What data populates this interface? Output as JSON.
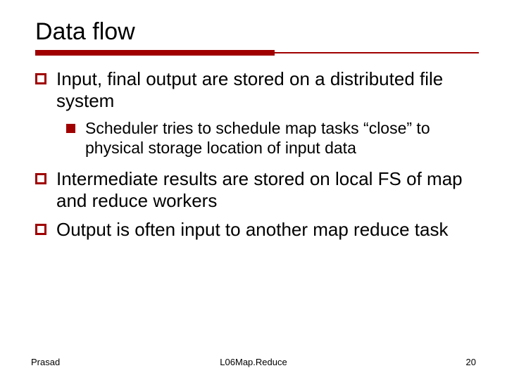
{
  "title": "Data flow",
  "bullets": {
    "b1": "Input, final output are stored on a distributed file system",
    "b1a": "Scheduler tries to schedule map tasks “close” to physical storage location of input data",
    "b2": "Intermediate results are stored on local FS of map and reduce workers",
    "b3": "Output is often input to another map reduce task"
  },
  "footer": {
    "left": "Prasad",
    "center": "L06Map.Reduce",
    "right": "20"
  },
  "colors": {
    "accent": "#a00000"
  }
}
